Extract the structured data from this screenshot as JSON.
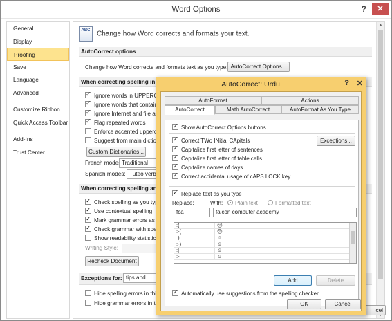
{
  "word_options": {
    "title": "Word Options",
    "help": "?",
    "close": "✕",
    "nav": [
      "General",
      "Display",
      "Proofing",
      "Save",
      "Language",
      "Advanced",
      "Customize Ribbon",
      "Quick Access Toolbar",
      "Add-Ins",
      "Trust Center"
    ],
    "selected_nav": "Proofing",
    "header": "Change how Word corrects and formats your text.",
    "header_icon_text": "ABC",
    "autocorrect_section": "AutoCorrect options",
    "autocorrect_desc": "Change how Word corrects and formats text as you type:",
    "autocorrect_button": "AutoCorrect Options...",
    "spelling_section": "When correcting spelling in Mi",
    "spelling_opts": [
      {
        "label": "Ignore words in UPPERCA",
        "checked": true
      },
      {
        "label": "Ignore words that contain",
        "checked": true
      },
      {
        "label": "Ignore Internet and file ac",
        "checked": true
      },
      {
        "label": "Flag repeated words",
        "checked": true
      },
      {
        "label": "Enforce accented upperca",
        "checked": false
      },
      {
        "label": "Suggest from main diction",
        "checked": false
      }
    ],
    "custom_dict_button": "Custom Dictionaries...",
    "french_label": "French modes:",
    "french_value": "Traditional",
    "spanish_label": "Spanish modes:",
    "spanish_value": "Tuteo verb",
    "grammar_section": "When correcting spelling and g",
    "grammar_opts": [
      {
        "label": "Check spelling as you type",
        "checked": true
      },
      {
        "label": "Use contextual spelling",
        "checked": true
      },
      {
        "label": "Mark grammar errors as yo",
        "checked": true
      },
      {
        "label": "Check grammar with spell",
        "checked": true
      },
      {
        "label": "Show readability statistics",
        "checked": false
      }
    ],
    "writing_style_label": "Writing Style:",
    "recheck_button": "Recheck Document",
    "exceptions_label": "Exceptions for:",
    "exceptions_value": "tips and",
    "exception_opts": [
      {
        "label": "Hide spelling errors in this",
        "checked": false
      },
      {
        "label": "Hide grammar errors in th",
        "checked": false
      }
    ],
    "cancel_partial": "cel"
  },
  "autocorrect": {
    "title": "AutoCorrect: Urdu",
    "help": "?",
    "close": "✕",
    "tabs_top": [
      "AutoFormat",
      "Actions"
    ],
    "tabs_bottom": [
      "AutoCorrect",
      "Math AutoCorrect",
      "AutoFormat As You Type"
    ],
    "active_tab": "AutoCorrect",
    "show_buttons": {
      "label": "Show AutoCorrect Options buttons",
      "checked": true
    },
    "options": [
      {
        "label": "Correct TWo INitial CApitals",
        "checked": true
      },
      {
        "label": "Capitalize first letter of sentences",
        "checked": true
      },
      {
        "label": "Capitalize first letter of table cells",
        "checked": true
      },
      {
        "label": "Capitalize names of days",
        "checked": true
      },
      {
        "label": "Correct accidental usage of cAPS LOCK key",
        "checked": true
      }
    ],
    "exceptions_button": "Exceptions...",
    "replace_as_type": {
      "label": "Replace text as you type",
      "checked": true
    },
    "replace_label": "Replace:",
    "with_label": "With:",
    "plain_text": "Plain text",
    "formatted_text": "Formatted text",
    "replace_value": "fca",
    "with_value": "falcon computer academy",
    "entries": [
      {
        "replace": ":(",
        "with": "☹"
      },
      {
        "replace": ":-(",
        "with": "☹"
      },
      {
        "replace": ":)",
        "with": "☺"
      },
      {
        "replace": ":-)",
        "with": "☺"
      },
      {
        "replace": ":|",
        "with": "☺"
      },
      {
        "replace": ":-|",
        "with": "☺"
      }
    ],
    "add_button": "Add",
    "delete_button": "Delete",
    "auto_suggest": {
      "label": "Automatically use suggestions from the spelling checker",
      "checked": true
    },
    "ok_button": "OK",
    "cancel_button": "Cancel"
  }
}
